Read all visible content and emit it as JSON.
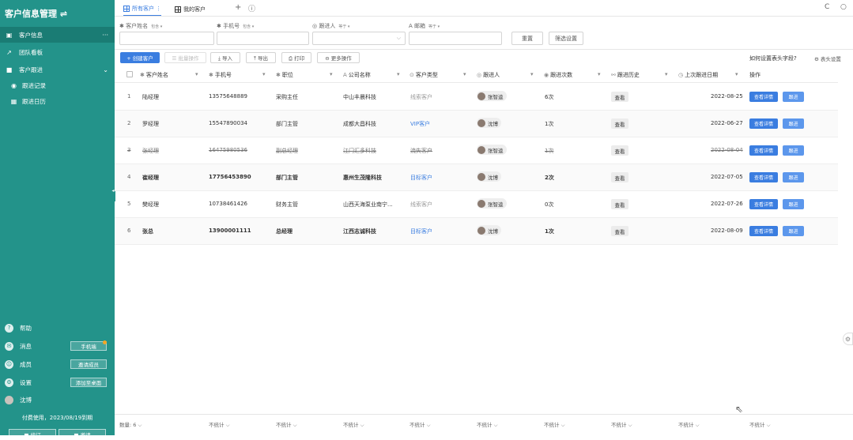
{
  "app": {
    "title": "客户信息管理",
    "switch_icon": "⇌"
  },
  "sidebar": {
    "items": [
      {
        "label": "客户信息",
        "icon": "contact-icon",
        "right": "···"
      },
      {
        "label": "团队看板",
        "icon": "chart-icon"
      },
      {
        "label": "客户跟进",
        "icon": "folder-icon",
        "right": "⌄"
      },
      {
        "label": "跟进记录",
        "icon": "eye-icon"
      },
      {
        "label": "跟进日历",
        "icon": "calendar-icon"
      }
    ],
    "bottom": [
      {
        "label": "帮助",
        "icon": "help-icon"
      },
      {
        "label": "消息",
        "icon": "message-icon",
        "action": "手机端"
      },
      {
        "label": "成员",
        "icon": "members-icon",
        "action": "邀请成员"
      },
      {
        "label": "设置",
        "icon": "settings-icon",
        "action": "添加至桌面"
      },
      {
        "label": "沈博",
        "icon": "avatar"
      }
    ],
    "expiry": "付费使用，2023/08/19到期",
    "btn_left": "■ 续订",
    "btn_right": "■ 邀请"
  },
  "tabs": [
    {
      "label": "所有客户 ⋮",
      "active": true
    },
    {
      "label": "我的客户",
      "active": false
    }
  ],
  "tab_add": "+",
  "tab_info": "ⓘ",
  "top_right": {
    "refresh": "C",
    "search": "○"
  },
  "filters": {
    "fields": [
      {
        "label": "客户姓名",
        "tag": "包含 ▾",
        "icon": "✱"
      },
      {
        "label": "手机号",
        "tag": "包含 ▾",
        "icon": "✱"
      },
      {
        "label": "跟进人",
        "tag": "等于 ▾",
        "icon": "◎"
      },
      {
        "label": "邮箱",
        "tag": "等于 ▾",
        "icon": "A"
      }
    ],
    "reset": "重置",
    "filter_settings": "筛选设置"
  },
  "toolbar": {
    "create": "+ 创建客户",
    "batch": "☰ 批量操作",
    "import": "⤓ 导入",
    "export": "⤒ 导出",
    "print": "⎙ 打印",
    "more": "⊖ 更多操作",
    "help_link": "如何设置表头字段?",
    "header_settings": "⚙ 表头设置"
  },
  "table": {
    "columns": [
      {
        "label": "客户姓名",
        "icon": "✱"
      },
      {
        "label": "手机号",
        "icon": "✱"
      },
      {
        "label": "职位",
        "icon": "✱"
      },
      {
        "label": "公司名称",
        "icon": "A"
      },
      {
        "label": "客户类型",
        "icon": "⊙"
      },
      {
        "label": "跟进人",
        "icon": "◎"
      },
      {
        "label": "跟进次数",
        "icon": "◉"
      },
      {
        "label": "跟进历史",
        "icon": "⚯"
      },
      {
        "label": "上次跟进日期",
        "icon": "◷"
      },
      {
        "label": "操作",
        "icon": ""
      }
    ],
    "sort_icon": "▾",
    "rows": [
      {
        "n": "1",
        "name": "陆经理",
        "phone": "13575648889",
        "title": "采购主任",
        "company": "中山丰晨科技",
        "type": "线索客户",
        "type_color": "#999999",
        "owner": "张智逵",
        "count": "6次",
        "history": "查看",
        "date": "2022-08-25",
        "detail": "查看详情",
        "follow": "跟进",
        "style": ""
      },
      {
        "n": "2",
        "name": "罗经理",
        "phone": "15547890034",
        "title": "部门主管",
        "company": "成都大昌科技",
        "type": "VIP客户",
        "type_color": "#3a7de0",
        "owner": "沈博",
        "count": "1次",
        "history": "查看",
        "date": "2022-06-27",
        "detail": "查看详情",
        "follow": "跟进",
        "style": ""
      },
      {
        "n": "3",
        "name": "张经理",
        "phone": "16475980536",
        "title": "副总经理",
        "company": "江门汇多科技",
        "type": "流失客户",
        "type_color": "#777777",
        "owner": "张智逵",
        "count": "1次",
        "history": "查看",
        "date": "2022-08-04",
        "detail": "查看详情",
        "follow": "跟进",
        "style": "strike"
      },
      {
        "n": "4",
        "name": "崔经理",
        "phone": "17756453890",
        "title": "部门主管",
        "company": "惠州生茂隆科技",
        "type": "目标客户",
        "type_color": "#3a7de0",
        "owner": "沈博",
        "count": "2次",
        "history": "查看",
        "date": "2022-07-05",
        "detail": "查看详情",
        "follow": "跟进",
        "style": "bold"
      },
      {
        "n": "5",
        "name": "樊经理",
        "phone": "10738461426",
        "title": "财务主管",
        "company": "山西天海泵业南宁...",
        "type": "线索客户",
        "type_color": "#999999",
        "owner": "张智逵",
        "count": "0次",
        "history": "查看",
        "date": "2022-07-26",
        "detail": "查看详情",
        "follow": "跟进",
        "style": ""
      },
      {
        "n": "6",
        "name": "张总",
        "phone": "13900001111",
        "title": "总经理",
        "company": "江西志诚科技",
        "type": "目标客户",
        "type_color": "#3a7de0",
        "owner": "沈博",
        "count": "1次",
        "history": "查看",
        "date": "2022-08-09",
        "detail": "查看详情",
        "follow": "跟进",
        "style": "bold"
      }
    ]
  },
  "footer": {
    "count": "数量: 6 ⌵",
    "stats": [
      "不统计 ⌵",
      "不统计 ⌵",
      "不统计 ⌵",
      "不统计 ⌵",
      "不统计 ⌵",
      "不统计 ⌵",
      "不统计 ⌵",
      "不统计 ⌵",
      "不统计 ⌵"
    ]
  }
}
